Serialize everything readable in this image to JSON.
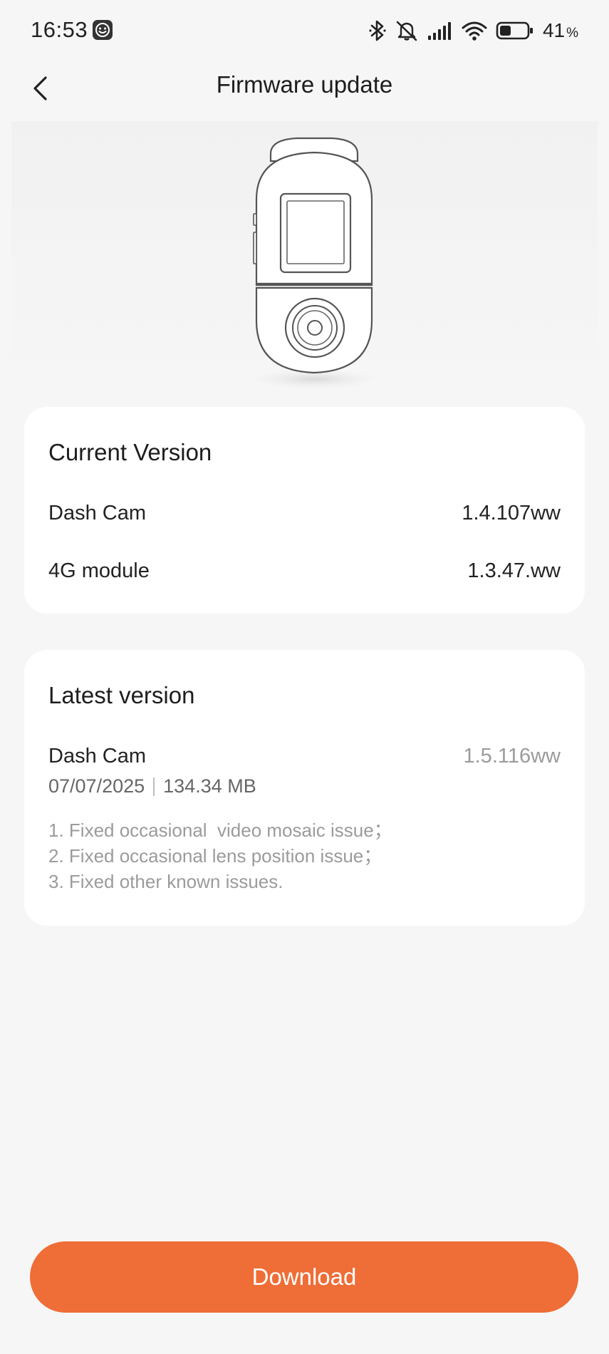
{
  "status_bar": {
    "time": "16:53",
    "icons": [
      "smiley-app-icon",
      "bluetooth-icon",
      "mute-icon",
      "signal-icon",
      "wifi-icon",
      "battery-icon"
    ],
    "battery_percent": "41",
    "battery_unit": "%",
    "battery_level": 0.41
  },
  "header": {
    "title": "Firmware update",
    "back_icon": "chevron-left-icon"
  },
  "device": {
    "image": "dash-cam-illustration"
  },
  "current_version": {
    "title": "Current Version",
    "rows": [
      {
        "label": "Dash Cam",
        "value": "1.4.107ww"
      },
      {
        "label": "4G module",
        "value": "1.3.47.ww"
      }
    ]
  },
  "latest_version": {
    "title": "Latest version",
    "device_label": "Dash Cam",
    "version": "1.5.116ww",
    "date": "07/07/2025",
    "size": "134.34 MB",
    "notes": [
      "1. Fixed occasional  video mosaic issue；",
      "2. Fixed occasional lens position issue；",
      "3. Fixed other known issues."
    ]
  },
  "actions": {
    "download_label": "Download"
  },
  "colors": {
    "background": "#f6f6f6",
    "card": "#ffffff",
    "accent": "#ef6d36",
    "muted_text": "#9b9b9b"
  }
}
